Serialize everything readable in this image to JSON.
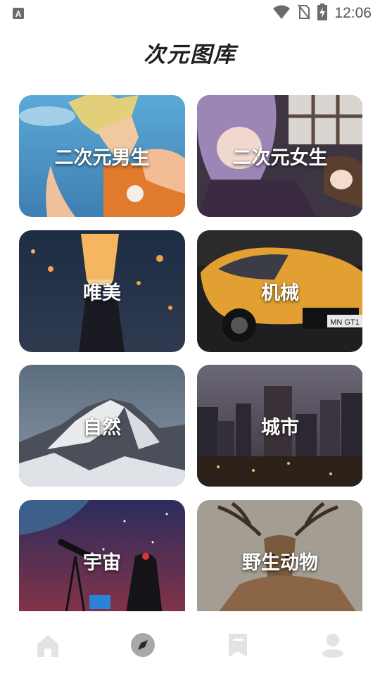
{
  "status_bar": {
    "time": "12:06",
    "icons": [
      "notification-a-icon",
      "wifi-icon",
      "no-sim-icon",
      "battery-charging-icon"
    ]
  },
  "header": {
    "title": "次元图库"
  },
  "categories": [
    {
      "label": "二次元男生"
    },
    {
      "label": "二次元女生"
    },
    {
      "label": "唯美"
    },
    {
      "label": "机械"
    },
    {
      "label": "自然"
    },
    {
      "label": "城市"
    },
    {
      "label": "宇宙"
    },
    {
      "label": "野生动物"
    }
  ],
  "bottom_nav": {
    "items": [
      {
        "icon": "home-icon",
        "active": false
      },
      {
        "icon": "compass-icon",
        "active": true
      },
      {
        "icon": "bookmark-icon",
        "active": false
      },
      {
        "icon": "user-icon",
        "active": false
      }
    ]
  },
  "colors": {
    "title": "#1f1f1f",
    "nav_inactive": "#e3e3e3",
    "nav_active": "#a8a8a8",
    "status_icons": "#6b6b6b"
  }
}
